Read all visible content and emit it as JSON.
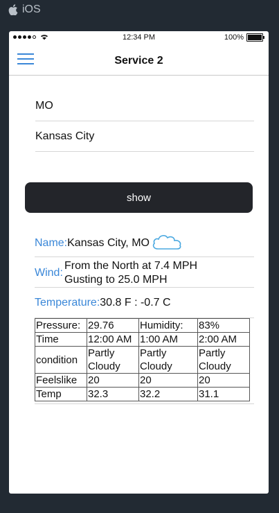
{
  "os": {
    "label": "iOS",
    "icon": "apple-icon"
  },
  "statusbar": {
    "time": "12:34 PM",
    "battery": "100%",
    "signal_icon": "signal-dots-icon",
    "wifi_icon": "wifi-icon",
    "battery_icon": "battery-icon",
    "battery_level": 1.0
  },
  "navbar": {
    "title": "Service 2",
    "menu_icon": "hamburger-menu-icon"
  },
  "form": {
    "state_value": "MO",
    "city_value": "Kansas City",
    "show_label": "show"
  },
  "info": {
    "name_label": "Name:",
    "name_value": "Kansas City, MO",
    "weather_icon": "cloud-icon",
    "wind_label": "Wind:",
    "wind_line1": "From the North at 7.4 MPH",
    "wind_line2": "Gusting to 25.0 MPH",
    "temp_label": "Temperature:",
    "temp_value": "30.8 F : -0.7 C"
  },
  "forecast": {
    "pressure_label": "Pressure:",
    "pressure_value": "29.76",
    "humidity_label": "Humidity:",
    "humidity_value": "83%",
    "rows": [
      {
        "label": "Time",
        "values": [
          "12:00 AM",
          "1:00 AM",
          "2:00 AM"
        ]
      },
      {
        "label": "condition",
        "values": [
          "Partly Cloudy",
          "Partly Cloudy",
          "Partly Cloudy"
        ]
      },
      {
        "label": "Feelslike",
        "values": [
          "20",
          "20",
          "20"
        ]
      },
      {
        "label": "Temp",
        "values": [
          "32.3",
          "32.2",
          "31.1"
        ]
      }
    ]
  }
}
